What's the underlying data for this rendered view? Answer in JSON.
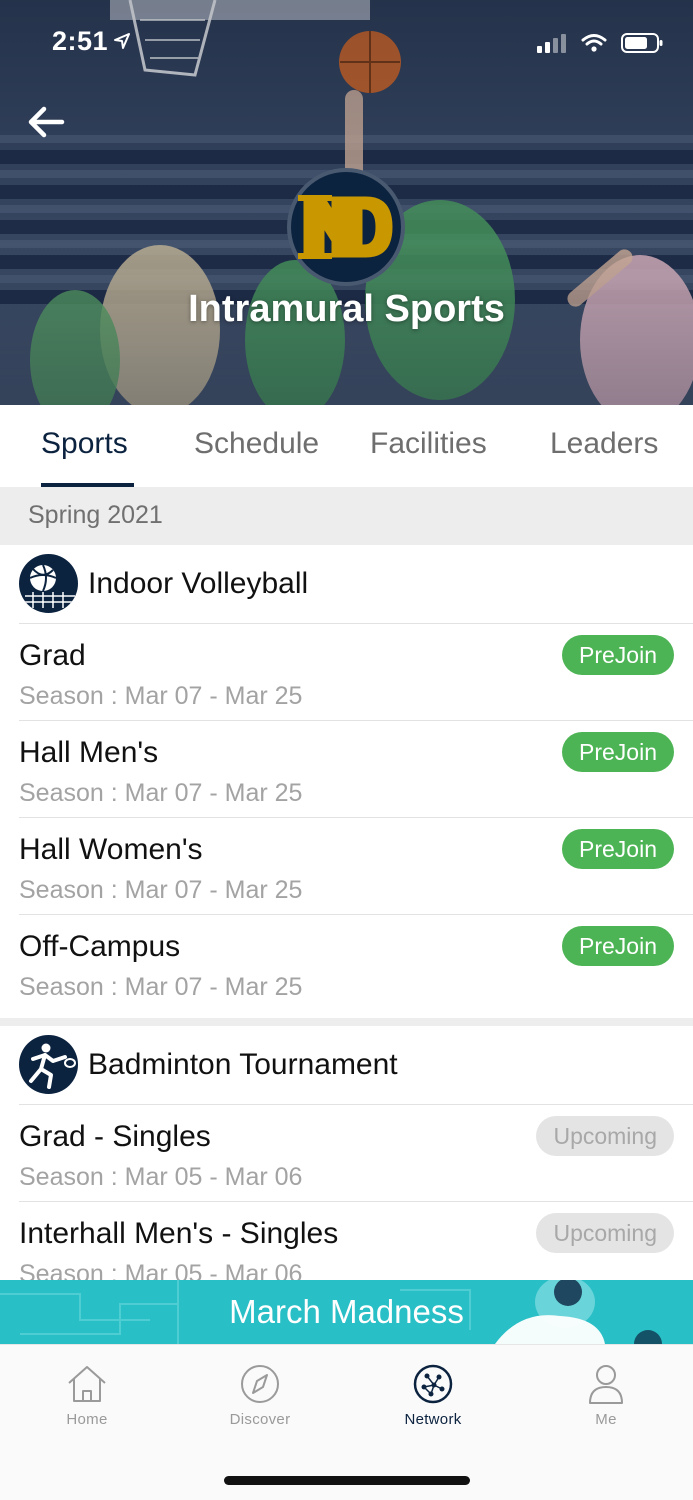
{
  "status_bar": {
    "time": "2:51"
  },
  "hero": {
    "title": "Intramural Sports",
    "logo_icon": "notre-dame-logo",
    "back_icon": "arrow-left-icon"
  },
  "tabs": [
    {
      "label": "Sports",
      "active": true
    },
    {
      "label": "Schedule",
      "active": false
    },
    {
      "label": "Facilities",
      "active": false
    },
    {
      "label": "Leaders",
      "active": false
    }
  ],
  "season_header": "Spring 2021",
  "groups": [
    {
      "title": "Indoor Volleyball",
      "icon": "volleyball-icon",
      "rows": [
        {
          "name": "Grad",
          "season": "Season : Mar 07 - Mar 25",
          "status": "PreJoin"
        },
        {
          "name": "Hall Men's",
          "season": "Season : Mar 07 - Mar 25",
          "status": "PreJoin"
        },
        {
          "name": "Hall Women's",
          "season": "Season : Mar 07 - Mar 25",
          "status": "PreJoin"
        },
        {
          "name": "Off-Campus",
          "season": "Season : Mar 07 - Mar 25",
          "status": "PreJoin"
        }
      ]
    },
    {
      "title": "Badminton Tournament",
      "icon": "badminton-icon",
      "rows": [
        {
          "name": "Grad - Singles",
          "season": "Season : Mar 05 - Mar 06",
          "status": "Upcoming"
        },
        {
          "name": "Interhall Men's - Singles",
          "season": "Season : Mar 05 - Mar 06",
          "status": "Upcoming"
        }
      ]
    }
  ],
  "banner": {
    "text": "March Madness"
  },
  "bottom_nav": [
    {
      "label": "Home",
      "icon": "home-icon",
      "active": false
    },
    {
      "label": "Discover",
      "icon": "compass-icon",
      "active": false
    },
    {
      "label": "Network",
      "icon": "network-icon",
      "active": true
    },
    {
      "label": "Me",
      "icon": "person-icon",
      "active": false
    }
  ],
  "colors": {
    "navy": "#0c2340",
    "gold": "#c99700",
    "prejoin_green": "#4cb454",
    "banner_teal": "#28bfc6",
    "upcoming_gray": "#e4e4e4"
  }
}
